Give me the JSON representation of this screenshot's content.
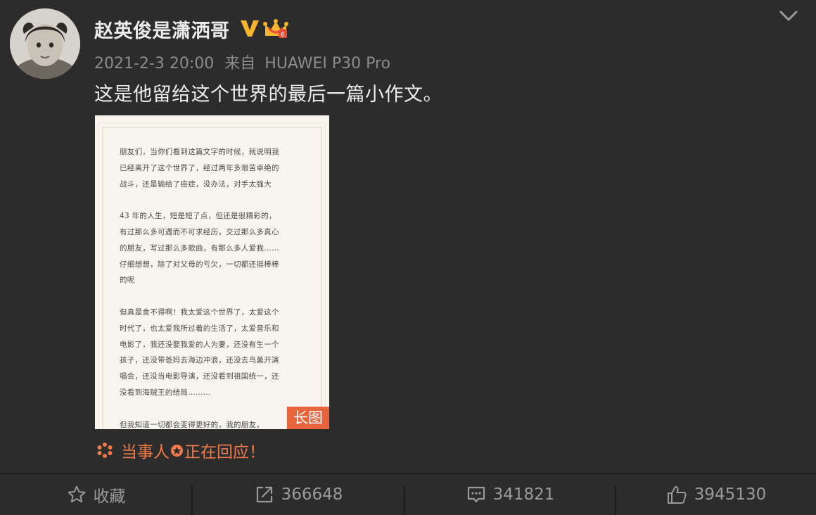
{
  "user": {
    "name": "赵英俊是潇洒哥",
    "verified_badge": "V",
    "verified_color": "#f5b52e"
  },
  "meta": {
    "timestamp": "2021-2-3 20:00",
    "source_prefix": "来自",
    "device": "HUAWEI P30 Pro"
  },
  "post": {
    "text": "这是他留给这个世界的最后一篇小作文。"
  },
  "image": {
    "badge": "长图",
    "lines": [
      "朋友们，当你们看到这篇文字的时候，就说明我",
      "已经离开了这个世界了，经过两年多艰苦卓绝的",
      "战斗，还是输给了癌症，没办法，对手太强大",
      "",
      "43 年的人生，短是短了点，但还是很精彩的，",
      "有过那么多可遇而不可求经历，交过那么多真心",
      "的朋友，写过那么多歌曲，有那么多人爱我……",
      "仔细想想，除了对父母的亏欠，一切都还挺棒棒",
      "的呢",
      "",
      "但真是舍不得啊！我太爱这个世界了，太爱这个",
      "时代了，也太爱我所过着的生活了，太爱音乐和",
      "电影了，我还没娶我爱的人为妻，还没有生一个",
      "孩子，还没带爸妈去海边冲浪，还没去鸟巢开演",
      "唱会，还没当电影导演，还没看到祖国统一，还",
      "没看到海贼王的结局………",
      "",
      "但我知道一切都会变得更好的，我的朋友，"
    ]
  },
  "responding": {
    "text_before": "当事人",
    "text_after": "正在回应！",
    "color": "#f07a4a"
  },
  "actions": {
    "favorite_label": "收藏",
    "share_count": "366648",
    "comment_count": "341821",
    "like_count": "3945130"
  }
}
